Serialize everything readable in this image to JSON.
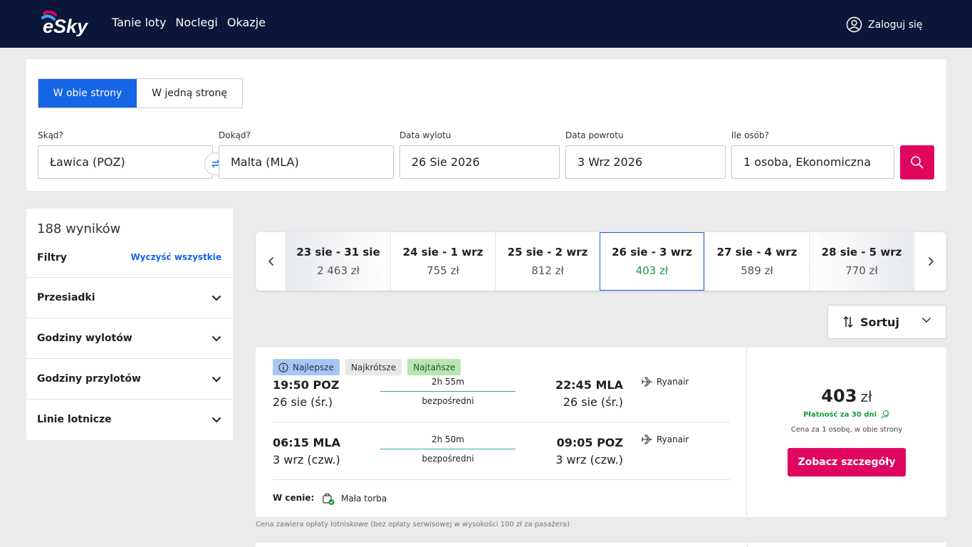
{
  "header": {
    "logo_text": "eSky",
    "nav": [
      "Tanie loty",
      "Noclegi",
      "Okazje"
    ],
    "login": "Zaloguj się"
  },
  "search": {
    "trip_types": {
      "round": "W obie strony",
      "oneway": "W jedną stronę",
      "selected": "round"
    },
    "from_label": "Skąd?",
    "from_value": "Ławica (POZ)",
    "to_label": "Dokąd?",
    "to_value": "Malta (MLA)",
    "dep_label": "Data wylotu",
    "dep_value": "26 Sie 2026",
    "ret_label": "Data powrotu",
    "ret_value": "3 Wrz 2026",
    "pax_label": "Ile osób?",
    "pax_value": "1 osoba, Ekonomiczna"
  },
  "filters": {
    "results": "188 wyników",
    "title": "Filtry",
    "clear": "Wyczyść wszystkie",
    "items": [
      "Przesiadki",
      "Godziny wylotów",
      "Godziny przylotów",
      "Linie lotnicze"
    ]
  },
  "dates": [
    {
      "range": "23 sie - 31 sie",
      "price": "2 463 zł"
    },
    {
      "range": "24 sie - 1 wrz",
      "price": "755 zł"
    },
    {
      "range": "25 sie - 2 wrz",
      "price": "812 zł"
    },
    {
      "range": "26 sie - 3 wrz",
      "price": "403 zł",
      "selected": true
    },
    {
      "range": "27 sie - 4 wrz",
      "price": "589 zł"
    },
    {
      "range": "28 sie - 5 wrz",
      "price": "770 zł"
    }
  ],
  "sort": {
    "label": "Sortuj"
  },
  "result": {
    "tags": [
      "Najlepsze",
      "Najkrótsze",
      "Najtańsze"
    ],
    "outbound": {
      "dep_time": "19:50 POZ",
      "dep_date": "26 sie (śr.)",
      "duration": "2h 55m",
      "stops": "bezpośredni",
      "arr_time": "22:45 MLA",
      "arr_date": "26 sie (śr.)",
      "airline": "Ryanair"
    },
    "inbound": {
      "dep_time": "06:15 MLA",
      "dep_date": "3 wrz (czw.)",
      "duration": "2h 50m",
      "stops": "bezpośredni",
      "arr_time": "09:05 POZ",
      "arr_date": "3 wrz (czw.)",
      "airline": "Ryanair"
    },
    "included_label": "W cenie:",
    "included_item": "Mała torba",
    "price": "403",
    "currency": "zł",
    "pay_later": "Płatność za 30 dni",
    "per_person": "Cena za 1 osobę, w obie strony",
    "details_button": "Zobacz szczegóły"
  },
  "fee_note": "Cena zawiera opłaty lotniskowe (bez opłaty serwisowej w wysokości 100 zł za pasażera)",
  "colors": {
    "header_bg": "#0b1738",
    "accent_blue": "#1565e6",
    "cta_pink": "#e0065f",
    "price_green": "#1e9a3c"
  }
}
